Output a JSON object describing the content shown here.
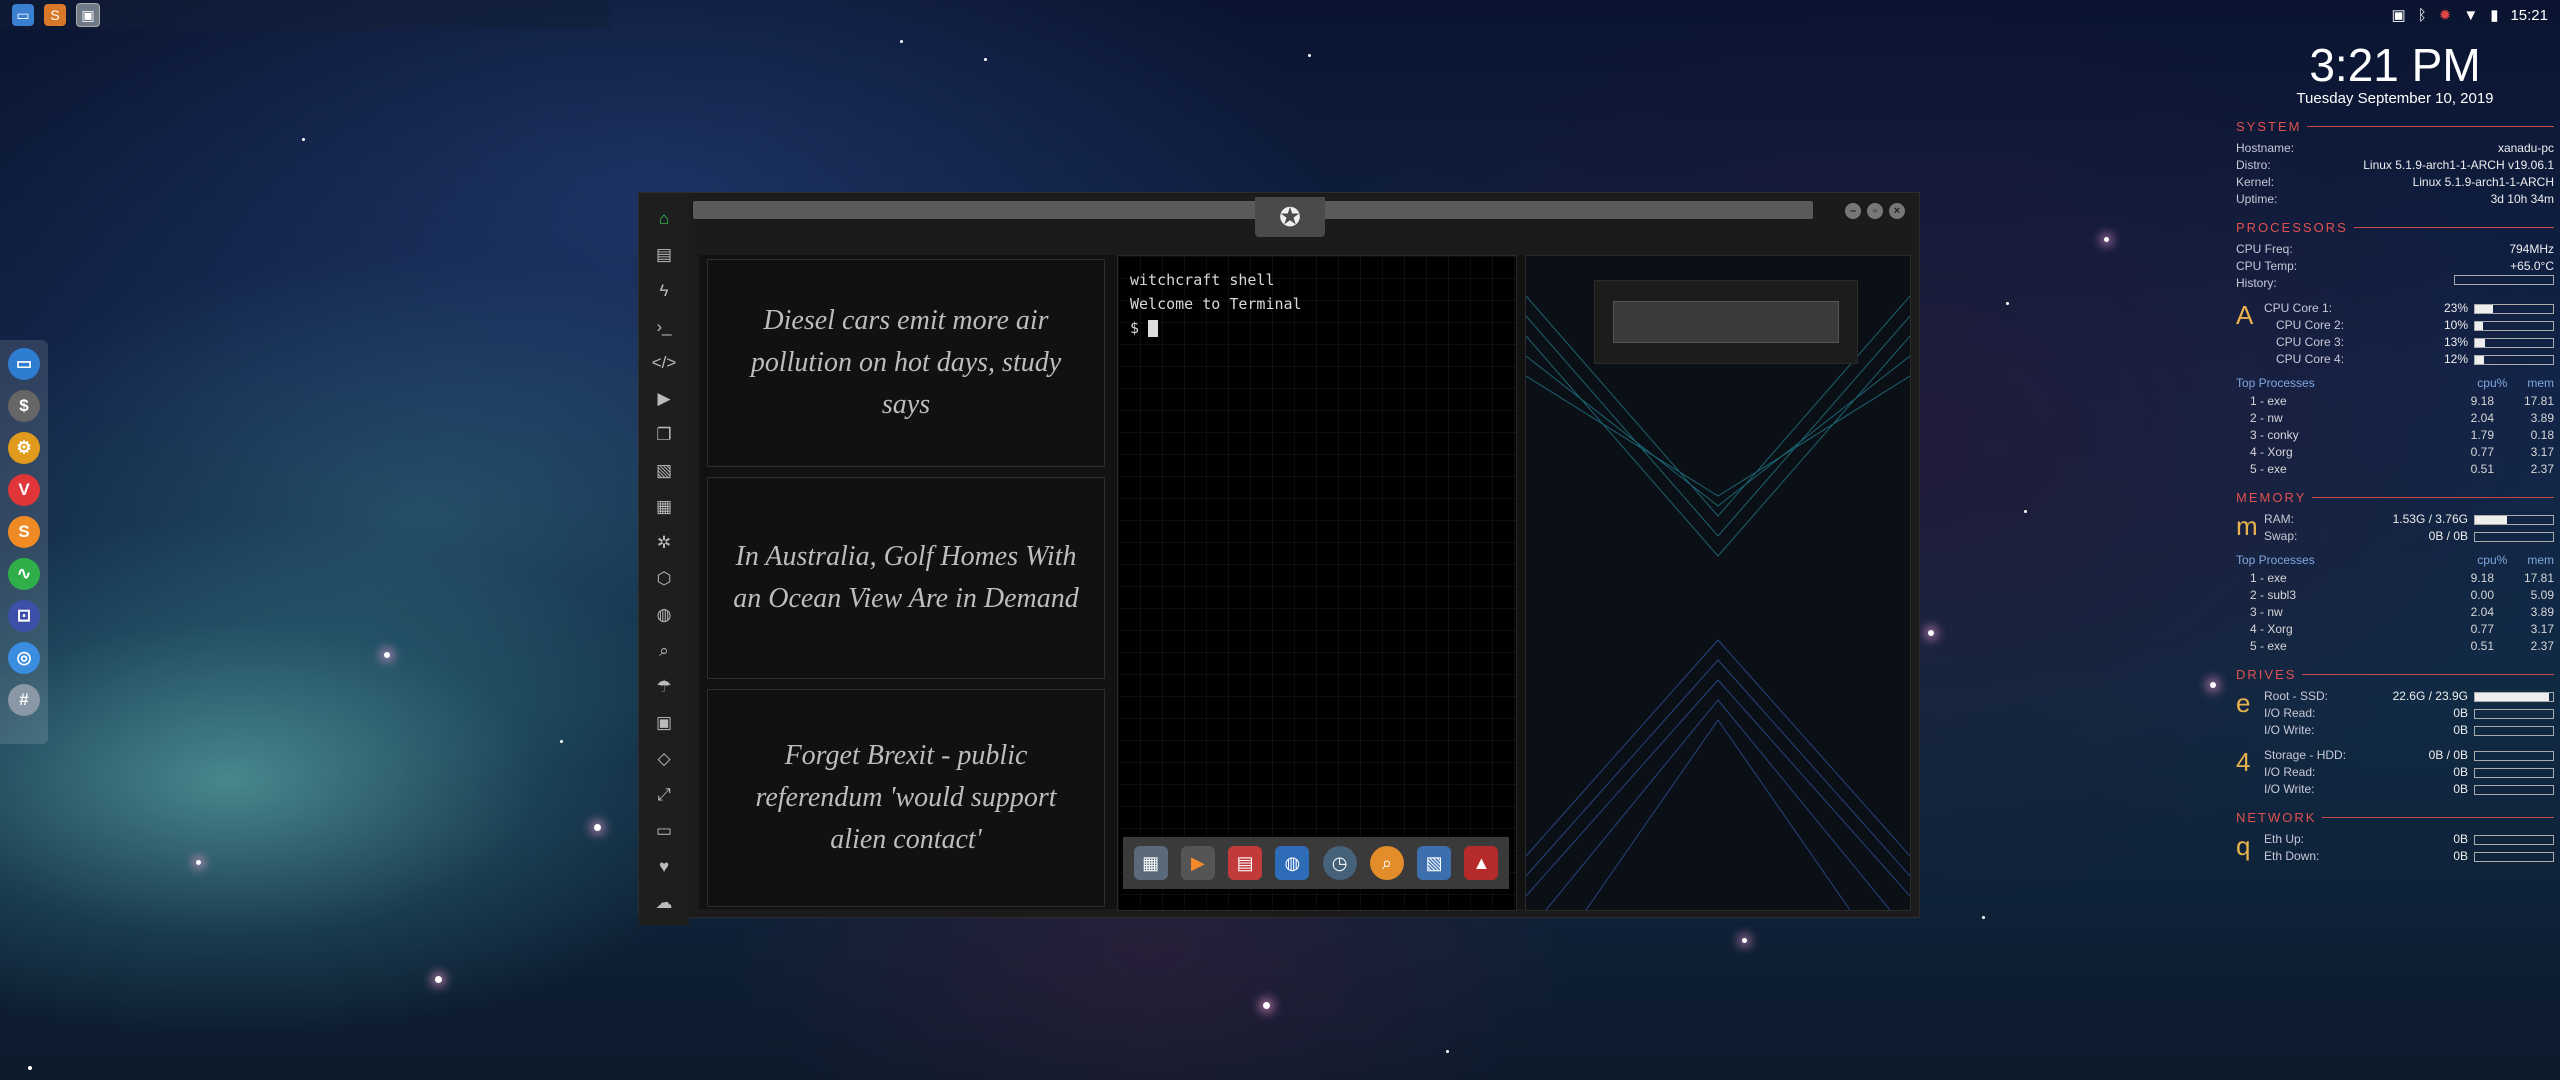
{
  "topbar": {
    "apps": [
      "file-manager-icon",
      "sublime-text-icon",
      "terminal-window-icon"
    ],
    "time": "15:21"
  },
  "dock": {
    "items": [
      "file-manager",
      "money-app",
      "settings",
      "vivaldi-browser",
      "sublime-text",
      "system-monitor",
      "remote-desktop",
      "chrome-browser",
      "web-grid"
    ]
  },
  "window": {
    "sidebar": [
      "home",
      "document",
      "lightning",
      "terminal",
      "code",
      "play",
      "files",
      "image",
      "news",
      "settings",
      "hexagon",
      "globe",
      "search",
      "umbrella",
      "contacts",
      "code-branch",
      "expand",
      "youtube",
      "heart",
      "cloud"
    ],
    "news": [
      "Diesel cars emit more air pollution on hot days, study says",
      "In Australia, Golf Homes With an Ocean View Are in Demand",
      "Forget Brexit - public referendum 'would support alien contact'"
    ],
    "terminal": {
      "line1": "witchcraft shell",
      "line2": "Welcome to Terminal",
      "prompt": "$ "
    }
  },
  "conky": {
    "time": "3:21 PM",
    "date": "Tuesday September 10, 2019",
    "system": {
      "label": "SYSTEM",
      "hostname_k": "Hostname:",
      "hostname": "xanadu-pc",
      "distro_k": "Distro:",
      "distro": "Linux 5.1.9-arch1-1-ARCH v19.06.1",
      "kernel_k": "Kernel:",
      "kernel": "Linux 5.1.9-arch1-1-ARCH",
      "uptime_k": "Uptime:",
      "uptime": "3d 10h 34m"
    },
    "processors": {
      "label": "PROCESSORS",
      "freq_k": "CPU Freq:",
      "freq": "794MHz",
      "temp_k": "CPU Temp:",
      "temp": "+65.0°C",
      "history_k": "History:",
      "cores": [
        {
          "k": "CPU Core 1:",
          "v": "23%",
          "f": 0.23
        },
        {
          "k": "CPU Core 2:",
          "v": "10%",
          "f": 0.1
        },
        {
          "k": "CPU Core 3:",
          "v": "13%",
          "f": 0.13
        },
        {
          "k": "CPU Core 4:",
          "v": "12%",
          "f": 0.12
        }
      ],
      "top_label": "Top Processes",
      "cpu_h": "cpu%",
      "mem_h": "mem",
      "procs": [
        [
          "1 - exe",
          "9.18",
          "17.81"
        ],
        [
          "2 - nw",
          "2.04",
          "3.89"
        ],
        [
          "3 - conky",
          "1.79",
          "0.18"
        ],
        [
          "4 - Xorg",
          "0.77",
          "3.17"
        ],
        [
          "5 - exe",
          "0.51",
          "2.37"
        ]
      ]
    },
    "memory": {
      "label": "MEMORY",
      "ram_k": "RAM:",
      "ram": "1.53G / 3.76G",
      "ram_f": 0.41,
      "swap_k": "Swap:",
      "swap": "0B / 0B",
      "top_label": "Top Processes",
      "cpu_h": "cpu%",
      "mem_h": "mem",
      "procs": [
        [
          "1 - exe",
          "9.18",
          "17.81"
        ],
        [
          "2 - subl3",
          "0.00",
          "5.09"
        ],
        [
          "3 - nw",
          "2.04",
          "3.89"
        ],
        [
          "4 - Xorg",
          "0.77",
          "3.17"
        ],
        [
          "5 - exe",
          "0.51",
          "2.37"
        ]
      ]
    },
    "drives": {
      "label": "DRIVES",
      "root_k": "Root - SSD:",
      "root": "22.6G / 23.9G",
      "root_f": 0.95,
      "io_read_k": "I/O Read:",
      "io_write_k": "I/O Write:",
      "r1": "0B",
      "w1": "0B",
      "storage_k": "Storage - HDD:",
      "storage": "0B / 0B",
      "r2": "0B",
      "w2": "0B"
    },
    "network": {
      "label": "NETWORK",
      "up_k": "Eth Up:",
      "up": "0B",
      "down_k": "Eth Down:",
      "down": "0B"
    }
  }
}
